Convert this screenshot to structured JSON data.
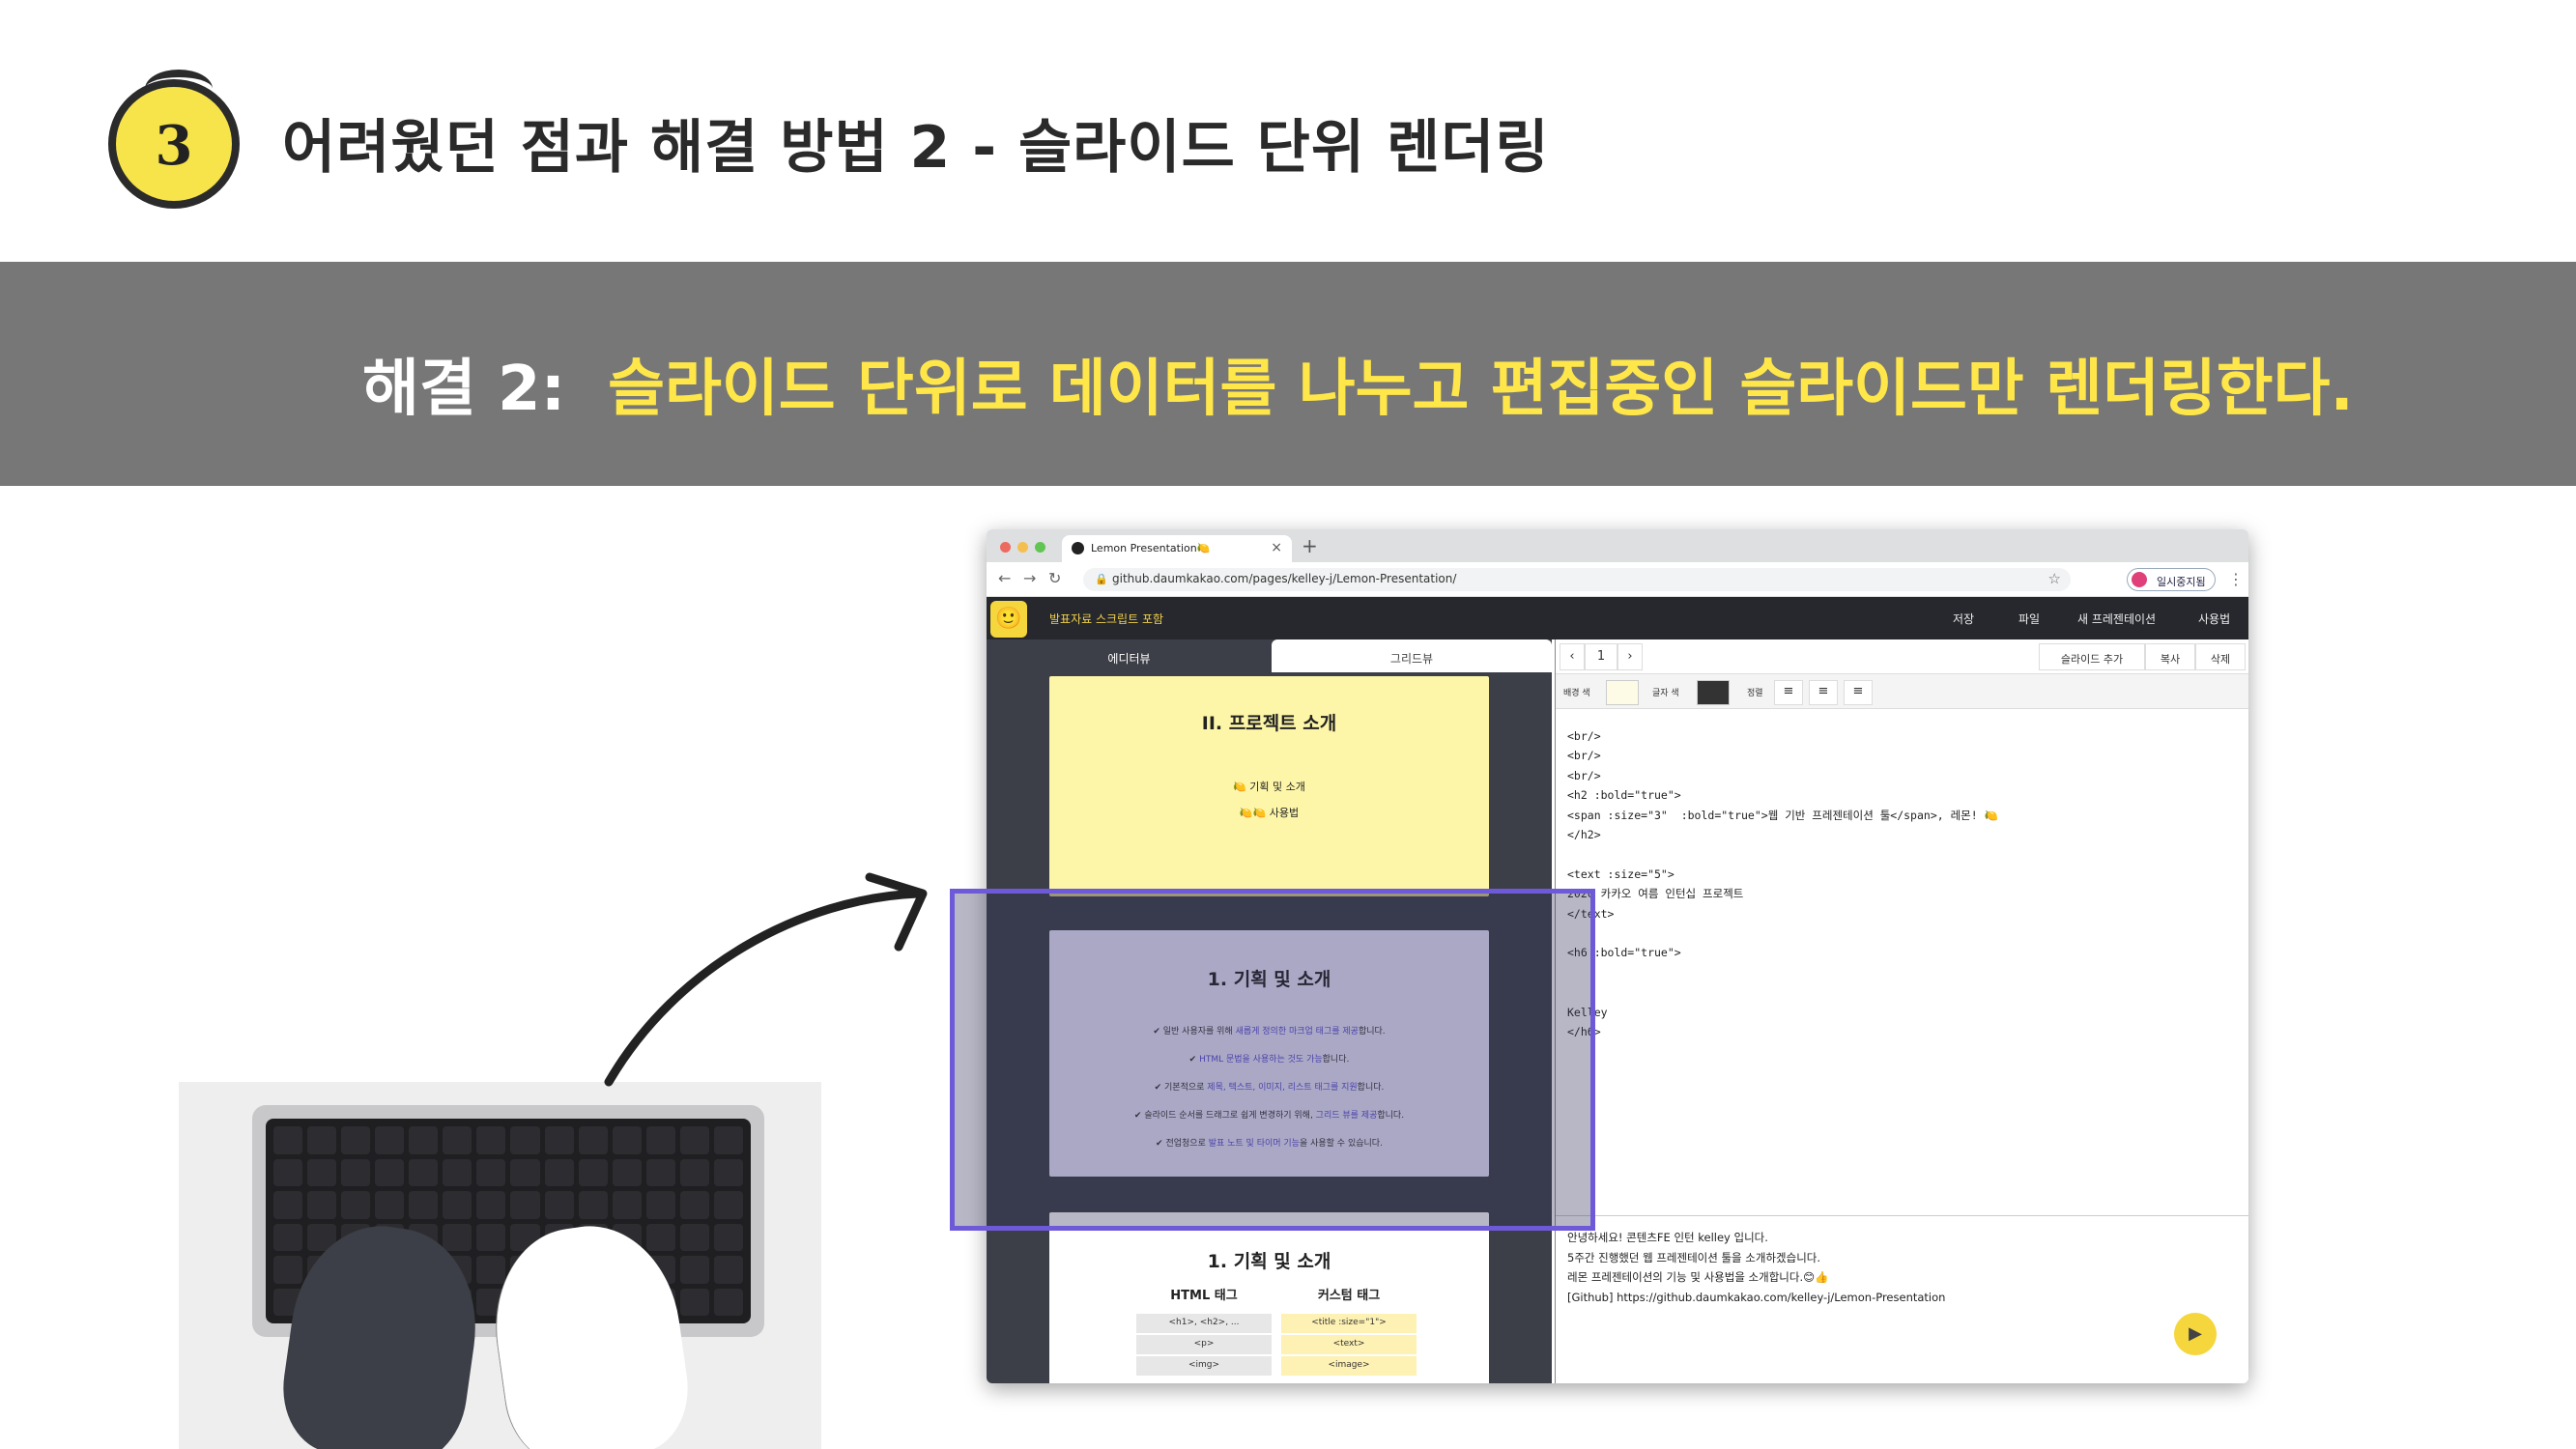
{
  "slide": {
    "number": "3",
    "title": "어려웠던 점과 해결 방법 2 - 슬라이드 단위 렌더링",
    "solution_label": "해결 2:",
    "solution_text": "슬라이드 단위로 데이터를 나누고 편집중인 슬라이드만 렌더링한다."
  },
  "browser": {
    "tab_title": "Lemon Presentation🍋",
    "tab_close": "×",
    "new_tab": "+",
    "url": "github.daumkakao.com/pages/kelley-j/Lemon-Presentation/",
    "profile_label": "일시중지됨"
  },
  "app": {
    "logo": "🙂",
    "title": "발표자료 스크립트 포함",
    "menu": [
      "저장",
      "파일",
      "새 프레젠테이션",
      "사용법"
    ],
    "view_tabs": {
      "editor": "에디터뷰",
      "grid": "그리드뷰"
    }
  },
  "slides": {
    "s1": {
      "title": "II. 프로젝트 소개",
      "bullets": [
        "🍋 기획 및 소개",
        "🍋🍋 사용법"
      ]
    },
    "s2": {
      "title": "1. 기획 및 소개",
      "items": [
        {
          "pre": "✔ 일반 사용자를 위해 ",
          "hl": "새롭게 정의한 마크업 태그를 제공",
          "post": "합니다."
        },
        {
          "pre": "✔ ",
          "hl": "HTML 문법을 사용하는 것도 가능",
          "post": "합니다."
        },
        {
          "pre": "✔ 기본적으로 ",
          "hl": "제목, 텍스트, 이미지, 리스트 태그를 지원",
          "post": "합니다."
        },
        {
          "pre": "✔ 슬라이드 순서를 드래그로 쉽게 변경하기 위해, ",
          "hl": "그리드 뷰를 제공",
          "post": "합니다."
        },
        {
          "pre": "✔ 전업청으로 ",
          "hl": "발표 노트 및 타이머 기능",
          "post": "을 사용할 수 있습니다."
        }
      ]
    },
    "s3": {
      "title": "1. 기획 및 소개",
      "col_html": "HTML 태그",
      "col_custom": "커스텀 태그",
      "html_cells": [
        "<h1>, <h2>, ...",
        "<p>",
        "<img>"
      ],
      "custom_cells": [
        "<title :size=\"1\">",
        "<text>",
        "<image>"
      ]
    }
  },
  "editor": {
    "prev": "‹",
    "page": "1",
    "next": "›",
    "actions": [
      "슬라이드 추가",
      "복사",
      "삭제"
    ],
    "bg_label": "배경 색",
    "text_label": "글자 색",
    "align_label": "정렬",
    "bg_color": "#fdfbe6",
    "text_color": "#333333",
    "code": "<br/>\n<br/>\n<br/>\n<h2 :bold=\"true\">\n<span :size=\"3\"  :bold=\"true\">웹 기반 프레젠테이션 툴</span>, 레몬! 🍋\n</h2>\n\n<text :size=\"5\">\n2020 카카오 여름 인턴십 프로젝트\n</text>\n\n<h6 :bold=\"true\">\n\n\nKelley\n</h6>",
    "script": "안녕하세요! 콘텐츠FE 인턴 kelley 입니다.\n5주간 진행했던 웹 프레젠테이션 툴을 소개하겠습니다.\n레몬 프레젠테이션의 기능 및 사용법을 소개합니다.😊👍\n[Github] https://github.daumkakao.com/kelley-j/Lemon-Presentation"
  },
  "colors": {
    "accent_yellow": "#ffe74a",
    "band_gray": "#777777",
    "highlight_purple": "#6e5ad8"
  }
}
